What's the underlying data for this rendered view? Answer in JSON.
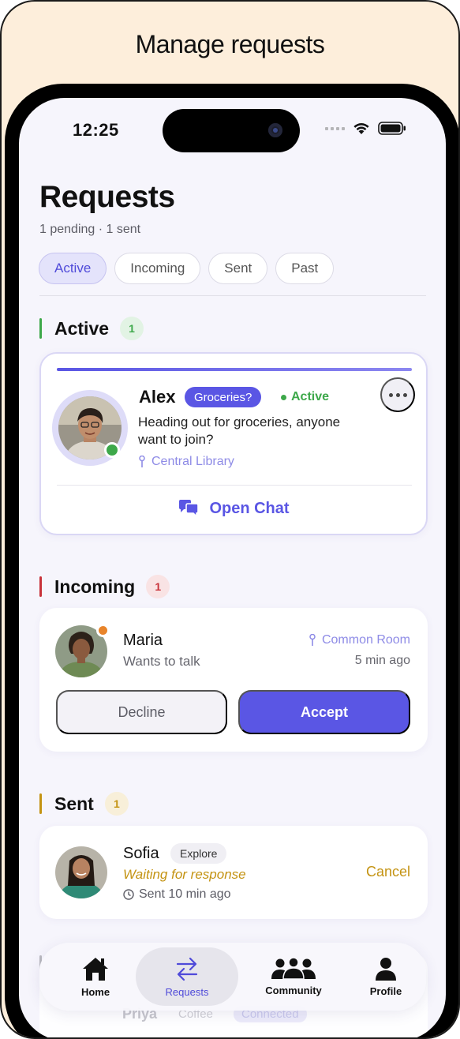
{
  "frame": {
    "title": "Manage requests"
  },
  "status_bar": {
    "time": "12:25"
  },
  "header": {
    "title": "Requests",
    "subtitle": "1 pending · 1 sent"
  },
  "filter_tabs": [
    {
      "label": "Active",
      "selected": true
    },
    {
      "label": "Incoming",
      "selected": false
    },
    {
      "label": "Sent",
      "selected": false
    },
    {
      "label": "Past",
      "selected": false
    }
  ],
  "sections": {
    "active": {
      "label": "Active",
      "count": "1",
      "accent": "#3DA84A"
    },
    "incoming": {
      "label": "Incoming",
      "count": "1",
      "accent": "#C8323A"
    },
    "sent": {
      "label": "Sent",
      "count": "1",
      "accent": "#C49312"
    }
  },
  "active_request": {
    "name": "Alex",
    "tag": "Groceries?",
    "status": "Active",
    "message": "Heading out for groceries, anyone want to join?",
    "location": "Central Library",
    "action": "Open Chat",
    "progress": 1.0
  },
  "incoming_request": {
    "name": "Maria",
    "subtitle": "Wants to talk",
    "location": "Common Room",
    "time": "5 min ago",
    "decline_label": "Decline",
    "accept_label": "Accept"
  },
  "sent_request": {
    "name": "Sofia",
    "tag": "Explore",
    "status": "Waiting for response",
    "time": "Sent 10 min ago",
    "cancel_label": "Cancel"
  },
  "past_peek": {
    "section_label": "Past",
    "name": "Priya",
    "tag": "Coffee",
    "status": "Connected"
  },
  "tab_bar": [
    {
      "label": "Home",
      "icon": "home-icon",
      "selected": false
    },
    {
      "label": "Requests",
      "icon": "swap-arrows-icon",
      "selected": true
    },
    {
      "label": "Community",
      "icon": "people-icon",
      "selected": false
    },
    {
      "label": "Profile",
      "icon": "person-icon",
      "selected": false
    }
  ],
  "colors": {
    "accent": "#5A56E4",
    "screen_bg": "#F6F5FC",
    "frame_bg": "#FDEEDB",
    "sent_accent": "#C49312"
  }
}
